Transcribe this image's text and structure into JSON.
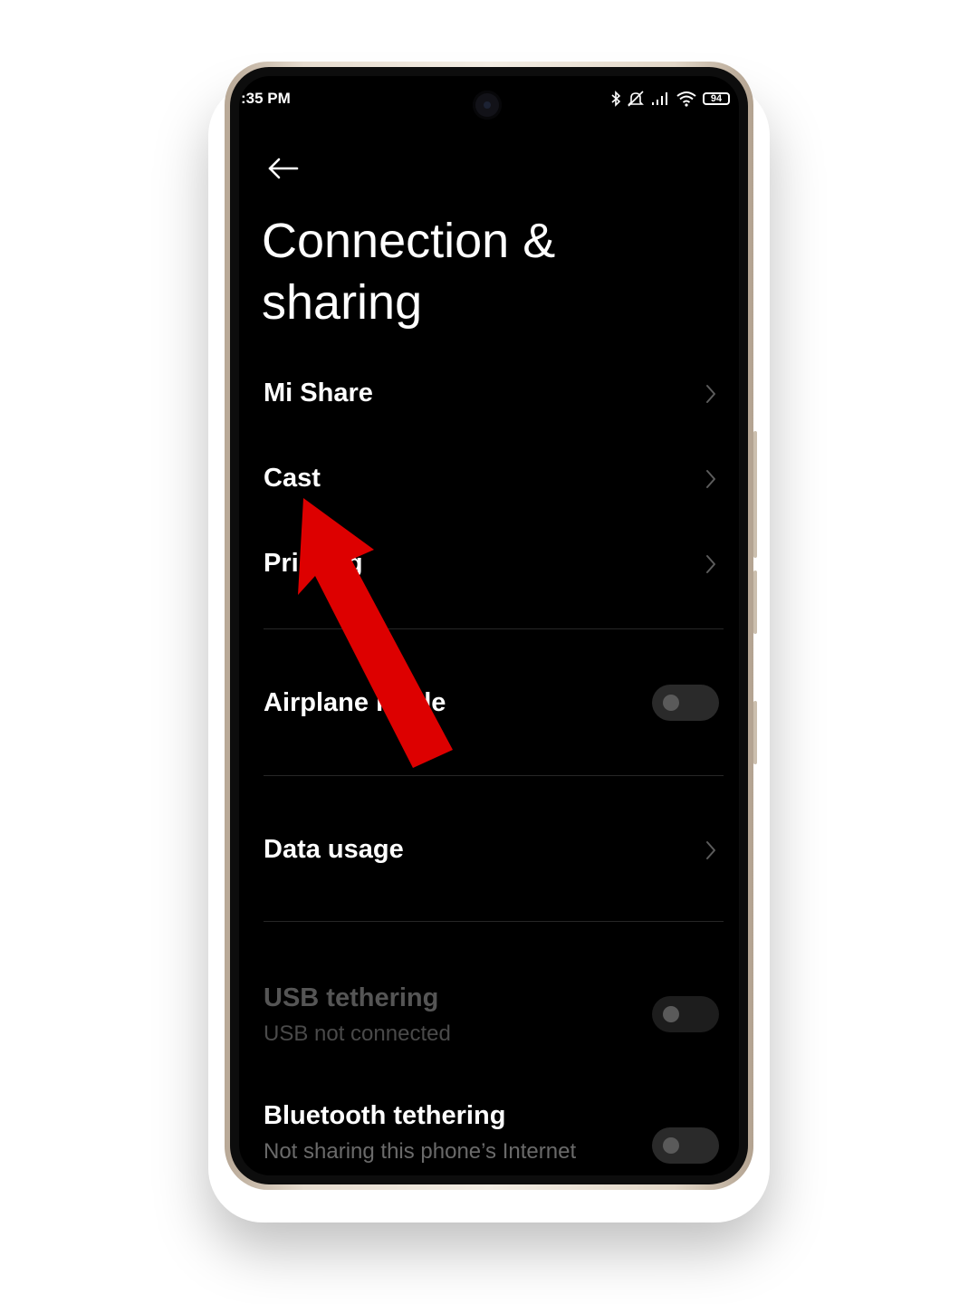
{
  "status_bar": {
    "time": ":35 PM",
    "battery": "94",
    "icons": [
      "bluetooth-icon",
      "mute-icon",
      "signal-icon",
      "wifi-icon",
      "battery-icon"
    ]
  },
  "header": {
    "back_icon": "back-arrow-icon",
    "title_line1": "Connection &",
    "title_line2": "sharing"
  },
  "items": [
    {
      "label": "Mi Share"
    },
    {
      "label": "Cast"
    },
    {
      "label": "Printing"
    }
  ],
  "airplane": {
    "label": "Airplane mode",
    "enabled": false
  },
  "data_usage": {
    "label": "Data usage"
  },
  "usb_tethering": {
    "label": "USB tethering",
    "sub": "USB not connected",
    "enabled": false,
    "disabled": true
  },
  "bluetooth_tethering": {
    "label": "Bluetooth tethering",
    "sub": "Not sharing this phone’s Internet",
    "enabled": false
  },
  "colors": {
    "annotation_arrow": "#dd0000",
    "background": "#000000",
    "frame": "#e6dccf"
  }
}
